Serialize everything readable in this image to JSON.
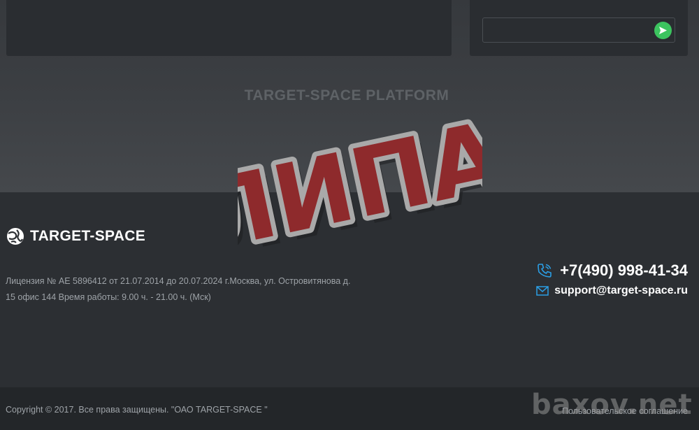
{
  "chat": {
    "message_value": "",
    "send_icon": "send-arrow-icon",
    "send_color": "#3cc45f"
  },
  "platform": {
    "title": "TARGET-SPACE PLATFORM"
  },
  "brand": {
    "logo_icon": "globe-logo-icon",
    "name": "TARGET-SPACE"
  },
  "license": {
    "line1": "Лицензия № АЕ 5896412 от 21.07.2014 до 20.07.2024 г.Москва, ул. Островитянова д.",
    "line2": "15 офис 144 Время работы: 9.00 ч. - 21.00 ч. (Мск)"
  },
  "contacts": {
    "phone_icon": "phone-icon",
    "phone": "+7(490) 998-41-34",
    "email_icon": "envelope-icon",
    "email": "support@target-space.ru",
    "icon_color": "#2b9fe6"
  },
  "footer": {
    "copyright": "Copyright © 2017. Все права защищены. \"ОАО TARGET-SPACE \"",
    "agreement": "Пользовательское соглашение"
  },
  "overlay": {
    "stamp_text": "ЛИПА",
    "stamp_color": "#8e2a2c",
    "watermark": "baxov.net"
  }
}
